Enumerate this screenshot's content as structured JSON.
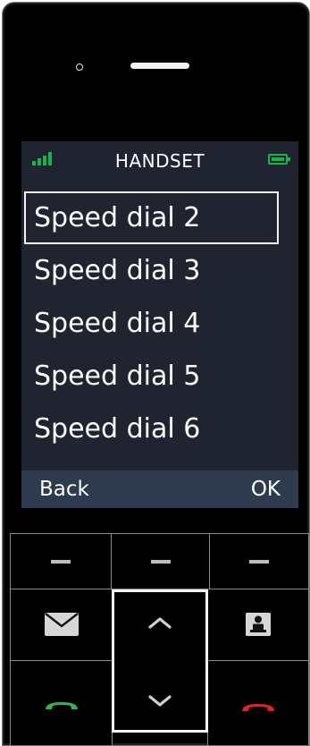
{
  "status_bar": {
    "title": "HANDSET",
    "signal_icon": "signal-bars-icon",
    "battery_icon": "battery-full-icon",
    "accent_color": "#19b34a"
  },
  "menu": {
    "items": [
      {
        "label": "Speed dial 2",
        "selected": true
      },
      {
        "label": "Speed dial 3",
        "selected": false
      },
      {
        "label": "Speed dial 4",
        "selected": false
      },
      {
        "label": "Speed dial 5",
        "selected": false
      },
      {
        "label": "Speed dial 6",
        "selected": false
      }
    ]
  },
  "softkeys": {
    "left": "Back",
    "right": "OK"
  },
  "keypad": {
    "softkey_left_icon": "dash-icon",
    "softkey_middle_icon": "dash-icon",
    "softkey_right_icon": "dash-icon",
    "message_icon": "envelope-icon",
    "contacts_icon": "contacts-icon",
    "nav_up_icon": "chevron-up-icon",
    "nav_down_icon": "chevron-down-icon",
    "call_icon": "phone-call-icon",
    "end_call_icon": "phone-end-icon",
    "call_color": "#36b44a",
    "end_color": "#e32222"
  }
}
